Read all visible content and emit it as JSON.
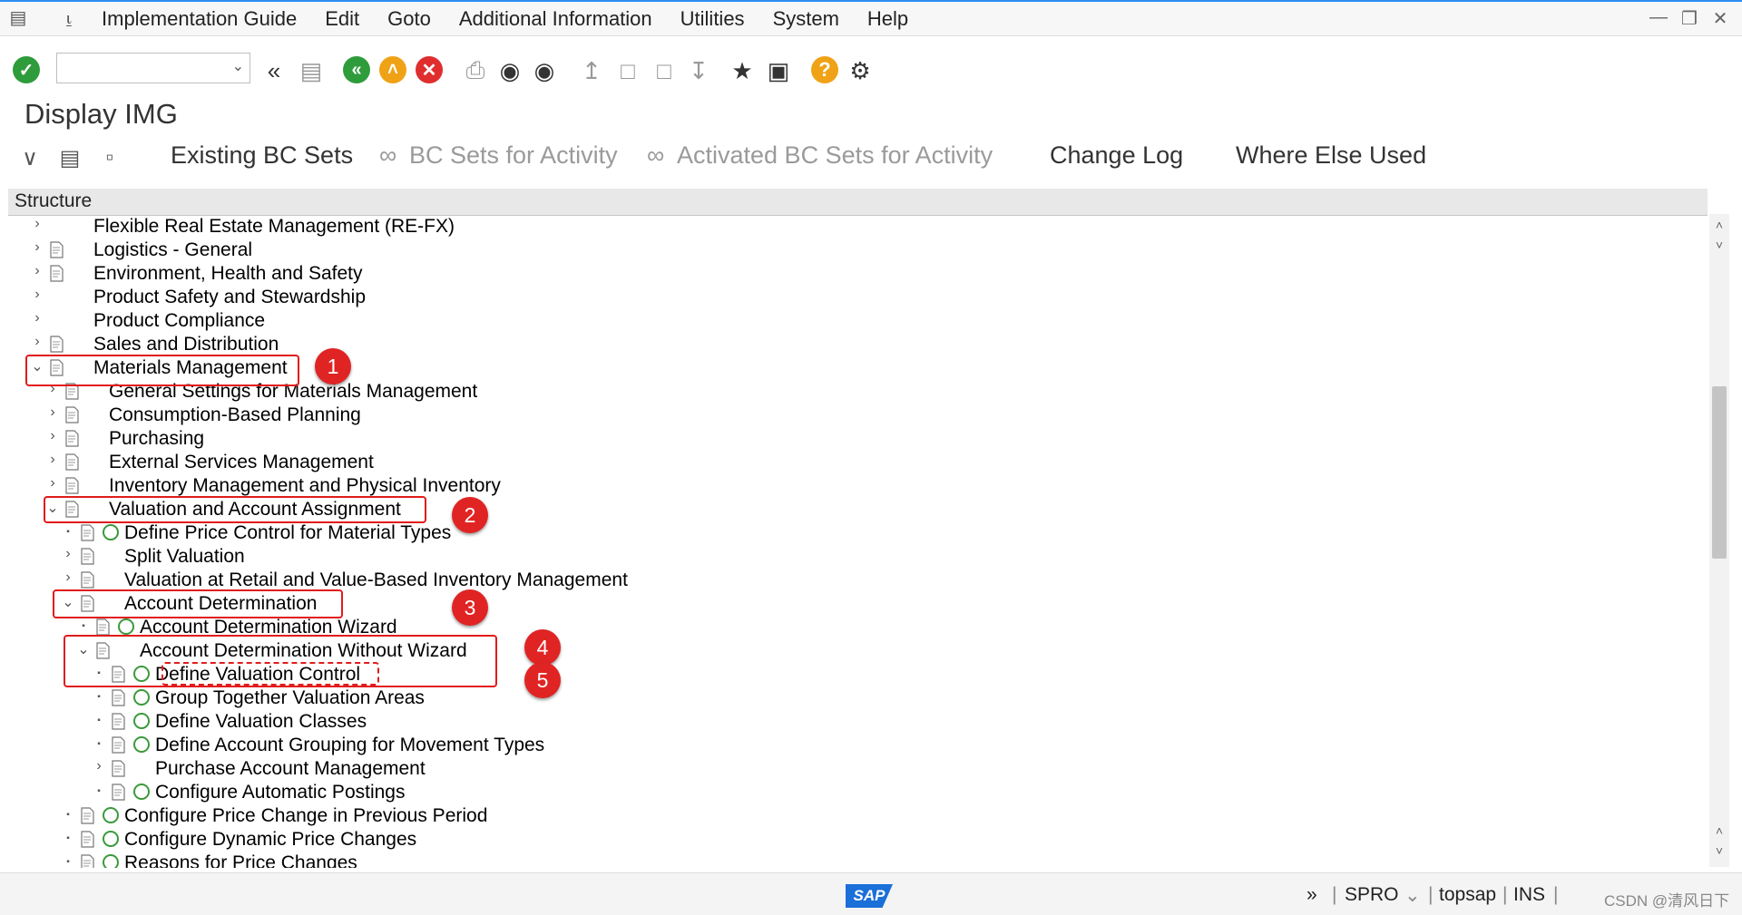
{
  "menu": {
    "items": [
      "Implementation Guide",
      "Edit",
      "Goto",
      "Additional Information",
      "Utilities",
      "System",
      "Help"
    ]
  },
  "toolbar": {
    "command_value": ""
  },
  "page": {
    "title": "Display IMG"
  },
  "app_toolbar": {
    "existing_bc_sets": "Existing BC Sets",
    "bc_sets_for_activity": "BC Sets for Activity",
    "activated_bc_sets": "Activated BC Sets for Activity",
    "change_log": "Change Log",
    "where_else_used": "Where Else Used"
  },
  "tree": {
    "header": "Structure",
    "rows": [
      {
        "label": "Flexible Real Estate Management (RE-FX)",
        "level": 0,
        "expand": "collapsed",
        "doc": false,
        "exec": false
      },
      {
        "label": "Logistics - General",
        "level": 0,
        "expand": "collapsed",
        "doc": true,
        "exec": false
      },
      {
        "label": "Environment, Health and Safety",
        "level": 0,
        "expand": "collapsed",
        "doc": true,
        "exec": false
      },
      {
        "label": "Product Safety and Stewardship",
        "level": 0,
        "expand": "collapsed",
        "doc": false,
        "exec": false
      },
      {
        "label": "Product Compliance",
        "level": 0,
        "expand": "collapsed",
        "doc": false,
        "exec": false
      },
      {
        "label": "Sales and Distribution",
        "level": 0,
        "expand": "collapsed",
        "doc": true,
        "exec": false
      },
      {
        "label": "Materials Management",
        "level": 0,
        "expand": "expanded",
        "doc": true,
        "exec": false
      },
      {
        "label": "General Settings for Materials Management",
        "level": 1,
        "expand": "collapsed",
        "doc": true,
        "exec": false
      },
      {
        "label": "Consumption-Based Planning",
        "level": 1,
        "expand": "collapsed",
        "doc": true,
        "exec": false
      },
      {
        "label": "Purchasing",
        "level": 1,
        "expand": "collapsed",
        "doc": true,
        "exec": false
      },
      {
        "label": "External Services Management",
        "level": 1,
        "expand": "collapsed",
        "doc": true,
        "exec": false
      },
      {
        "label": "Inventory Management and Physical Inventory",
        "level": 1,
        "expand": "collapsed",
        "doc": true,
        "exec": false
      },
      {
        "label": "Valuation and Account Assignment",
        "level": 1,
        "expand": "expanded",
        "doc": true,
        "exec": false
      },
      {
        "label": "Define Price Control for Material Types",
        "level": 2,
        "expand": "leaf",
        "doc": true,
        "exec": true
      },
      {
        "label": "Split Valuation",
        "level": 2,
        "expand": "collapsed",
        "doc": true,
        "exec": false
      },
      {
        "label": "Valuation at Retail and Value-Based Inventory Management",
        "level": 2,
        "expand": "collapsed",
        "doc": true,
        "exec": false
      },
      {
        "label": "Account Determination",
        "level": 2,
        "expand": "expanded",
        "doc": true,
        "exec": false
      },
      {
        "label": "Account Determination Wizard",
        "level": 3,
        "expand": "leaf",
        "doc": true,
        "exec": true
      },
      {
        "label": "Account Determination Without Wizard",
        "level": 3,
        "expand": "expanded",
        "doc": true,
        "exec": false
      },
      {
        "label": "Define Valuation Control",
        "level": 4,
        "expand": "leaf",
        "doc": true,
        "exec": true
      },
      {
        "label": "Group Together Valuation Areas",
        "level": 4,
        "expand": "leaf",
        "doc": true,
        "exec": true
      },
      {
        "label": "Define Valuation Classes",
        "level": 4,
        "expand": "leaf",
        "doc": true,
        "exec": true
      },
      {
        "label": "Define Account Grouping for Movement Types",
        "level": 4,
        "expand": "leaf",
        "doc": true,
        "exec": true
      },
      {
        "label": "Purchase Account Management",
        "level": 4,
        "expand": "collapsed",
        "doc": true,
        "exec": false
      },
      {
        "label": "Configure Automatic Postings",
        "level": 4,
        "expand": "leaf",
        "doc": true,
        "exec": true
      },
      {
        "label": "Configure Price Change in Previous Period",
        "level": 2,
        "expand": "leaf",
        "doc": true,
        "exec": true
      },
      {
        "label": "Configure Dynamic Price Changes",
        "level": 2,
        "expand": "leaf",
        "doc": true,
        "exec": true
      },
      {
        "label": "Reasons for Price Changes",
        "level": 2,
        "expand": "leaf",
        "doc": true,
        "exec": true
      }
    ]
  },
  "annotations": [
    {
      "number": "1"
    },
    {
      "number": "2"
    },
    {
      "number": "3"
    },
    {
      "number": "4"
    },
    {
      "number": "5"
    }
  ],
  "status": {
    "system": "SPRO",
    "user": "topsap",
    "mode": "INS",
    "watermark": "CSDN @清风日下"
  },
  "colors": {
    "accent": "#2a8ef0",
    "highlight": "#e21b1b",
    "ok": "#2e9c3a",
    "warn": "#f0a216",
    "error": "#e02e2e"
  }
}
